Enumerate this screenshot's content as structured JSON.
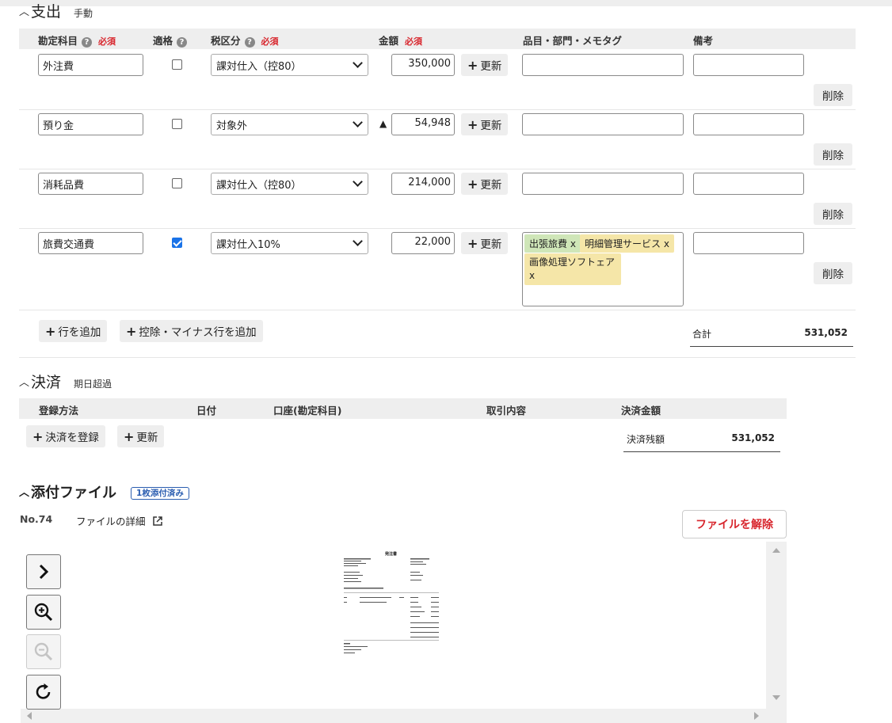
{
  "expense": {
    "title": "支出",
    "subtitle": "手動",
    "headers": {
      "account": "勘定科目",
      "qualified": "適格",
      "tax": "税区分",
      "amount": "金額",
      "items": "品目・部門・メモタグ",
      "remarks": "備考",
      "required": "必須"
    },
    "rows": [
      {
        "account": "外注費",
        "qualified": false,
        "tax": "課対仕入（控80）",
        "amount": "350,000",
        "minus": "",
        "update": "更新",
        "delete": "削除"
      },
      {
        "account": "預り金",
        "qualified": false,
        "tax": "対象外",
        "amount": "54,948",
        "minus": "▲",
        "update": "更新",
        "delete": "削除"
      },
      {
        "account": "消耗品費",
        "qualified": false,
        "tax": "課対仕入（控80）",
        "amount": "214,000",
        "minus": "",
        "update": "更新",
        "delete": "削除"
      },
      {
        "account": "旅費交通費",
        "qualified": true,
        "tax": "課対仕入10%",
        "amount": "22,000",
        "minus": "",
        "update": "更新",
        "delete": "削除",
        "tags": [
          {
            "label": "出張旅費",
            "remove": "x",
            "color": "#cfe6b8"
          },
          {
            "label": "明細管理サービス",
            "remove": "x",
            "color": "#f5e6a8"
          },
          {
            "label": "画像処理ソフトェア",
            "remove": "x",
            "color": "#f5e6a8"
          }
        ]
      }
    ],
    "add_row": "行を追加",
    "add_minus_row": "控除・マイナス行を追加",
    "total_label": "合計",
    "total_value": "531,052"
  },
  "settlement": {
    "title": "決済",
    "subtitle": "期日超過",
    "headers": {
      "method": "登録方法",
      "date": "日付",
      "account": "口座(勘定科目)",
      "content": "取引内容",
      "amount": "決済金額"
    },
    "register": "決済を登録",
    "update": "更新",
    "balance_label": "決済残額",
    "balance_value": "531,052"
  },
  "attachment": {
    "title": "添付ファイル",
    "badge": "1枚添付済み",
    "file_no": "No.74",
    "detail_link": "ファイルの詳細",
    "remove": "ファイルを解除",
    "doc_title": "発注書"
  },
  "colors": {
    "required": "#d8262d",
    "badge": "#2a5db0",
    "checkbox": "#1a73e8",
    "header_bg": "#eeeeee"
  }
}
